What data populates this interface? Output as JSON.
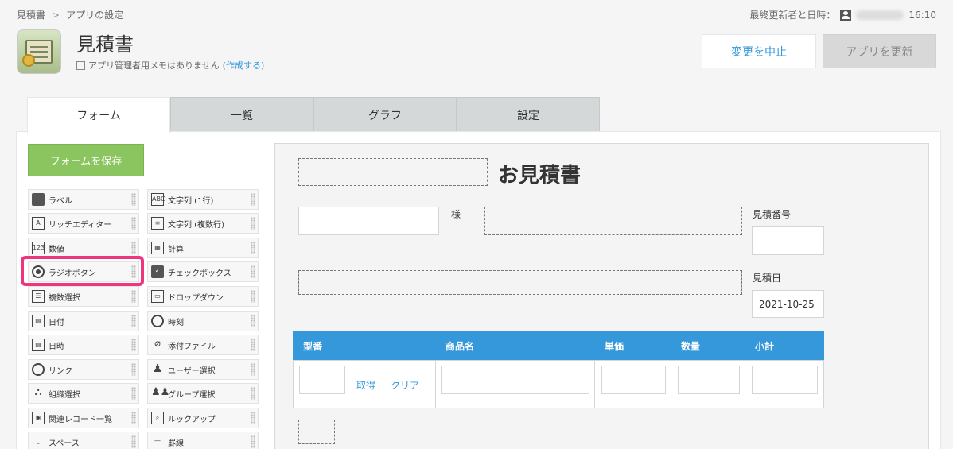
{
  "breadcrumb": {
    "root": "見積書",
    "separator": ">",
    "current": "アプリの設定"
  },
  "updated": {
    "label": "最終更新者と日時：",
    "time": "16:10"
  },
  "app": {
    "title": "見積書",
    "memo": "アプリ管理者用メモはありません",
    "memo_link": "(作成する)"
  },
  "actions": {
    "cancel": "変更を中止",
    "update": "アプリを更新"
  },
  "tabs": [
    {
      "label": "フォーム",
      "active": true
    },
    {
      "label": "一覧",
      "active": false
    },
    {
      "label": "グラフ",
      "active": false
    },
    {
      "label": "設定",
      "active": false
    }
  ],
  "save_label": "フォームを保存",
  "palette": [
    {
      "label": "ラベル",
      "icon": "tag-icon"
    },
    {
      "label": "文字列 (1行)",
      "icon": "abc-icon"
    },
    {
      "label": "リッチエディター",
      "icon": "rich-editor-icon"
    },
    {
      "label": "文字列 (複数行)",
      "icon": "multiline-text-icon"
    },
    {
      "label": "数値",
      "icon": "number-icon"
    },
    {
      "label": "計算",
      "icon": "calculator-icon"
    },
    {
      "label": "ラジオボタン",
      "icon": "radio-icon"
    },
    {
      "label": "チェックボックス",
      "icon": "checkbox-icon"
    },
    {
      "label": "複数選択",
      "icon": "multi-select-icon"
    },
    {
      "label": "ドロップダウン",
      "icon": "dropdown-icon"
    },
    {
      "label": "日付",
      "icon": "calendar-icon"
    },
    {
      "label": "時刻",
      "icon": "clock-icon"
    },
    {
      "label": "日時",
      "icon": "datetime-icon"
    },
    {
      "label": "添付ファイル",
      "icon": "paperclip-icon"
    },
    {
      "label": "リンク",
      "icon": "globe-icon"
    },
    {
      "label": "ユーザー選択",
      "icon": "user-icon"
    },
    {
      "label": "組織選択",
      "icon": "org-icon"
    },
    {
      "label": "グループ選択",
      "icon": "group-icon"
    },
    {
      "label": "関連レコード一覧",
      "icon": "related-records-icon"
    },
    {
      "label": "ルックアップ",
      "icon": "lookup-icon"
    },
    {
      "label": "スペース",
      "icon": "space-icon"
    },
    {
      "label": "罫線",
      "icon": "line-icon"
    }
  ],
  "form": {
    "doc_title": "お見積書",
    "honorific": "様",
    "estimate_no_label": "見積番号",
    "estimate_date_label": "見積日",
    "estimate_date_value": "2021-10-25",
    "table_headers": [
      "型番",
      "商品名",
      "単価",
      "数量",
      "小計"
    ],
    "fetch_link": "取得",
    "clear_link": "クリア"
  },
  "colors": {
    "accent": "#3498db",
    "save": "#8bc560",
    "highlight": "#f0357f"
  }
}
